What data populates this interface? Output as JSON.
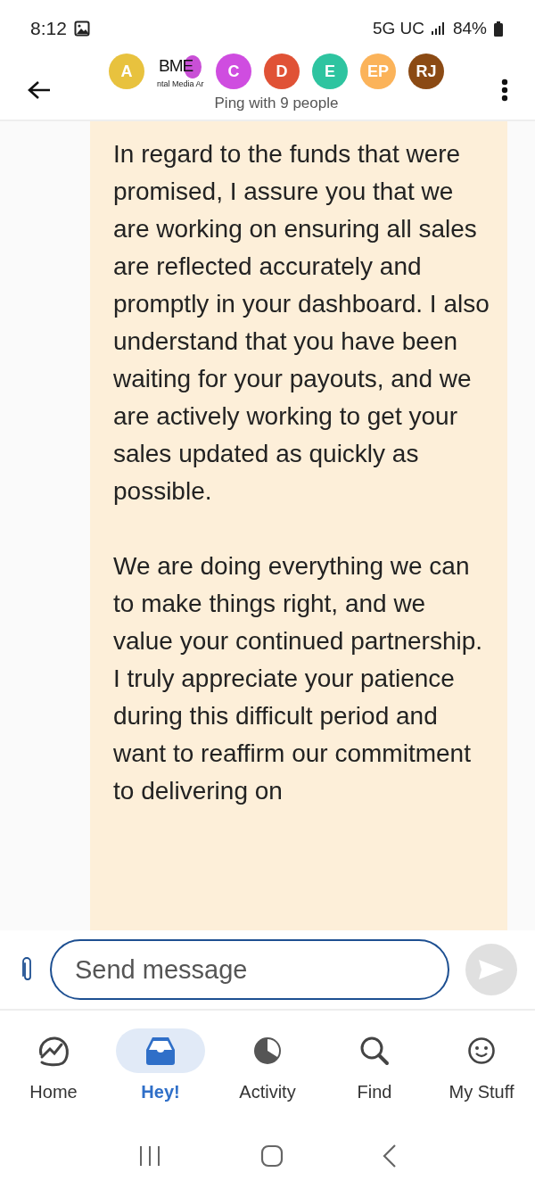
{
  "status_bar": {
    "time": "8:12",
    "network": "5G UC",
    "battery": "84%"
  },
  "header": {
    "avatars": [
      {
        "kind": "initials",
        "label": "A",
        "color": "#e8c23e"
      },
      {
        "kind": "logo",
        "label": "BME",
        "subtitle": "ntal Media Ar",
        "color": "#c94fd6"
      },
      {
        "kind": "initials",
        "label": "C",
        "color": "#cf4de0"
      },
      {
        "kind": "initials",
        "label": "D",
        "color": "#e05236"
      },
      {
        "kind": "initials",
        "label": "E",
        "color": "#2ec4a0"
      },
      {
        "kind": "initials",
        "label": "EP",
        "color": "#fbb35a"
      },
      {
        "kind": "initials",
        "label": "RJ",
        "color": "#8b4a14"
      }
    ],
    "subtitle": "Ping with 9 people"
  },
  "message": {
    "paragraphs": [
      "In regard to the funds that were promised, I assure you that we are working on ensuring all sales are reflected accurately and promptly in your dashboard. I also understand that you have been waiting for your payouts, and we are actively working to get your sales updated as quickly as possible.",
      "We are doing everything we can to make things right, and we value your continued partnership. I truly appreciate your patience during this difficult period and want to reaffirm our commitment to delivering on"
    ]
  },
  "composer": {
    "placeholder": "Send message"
  },
  "nav": [
    {
      "kind": "home",
      "label": "Home",
      "selected": false
    },
    {
      "kind": "hey",
      "label": "Hey!",
      "selected": true
    },
    {
      "kind": "activity",
      "label": "Activity",
      "selected": false
    },
    {
      "kind": "find",
      "label": "Find",
      "selected": false
    },
    {
      "kind": "stuff",
      "label": "My Stuff",
      "selected": false
    }
  ]
}
